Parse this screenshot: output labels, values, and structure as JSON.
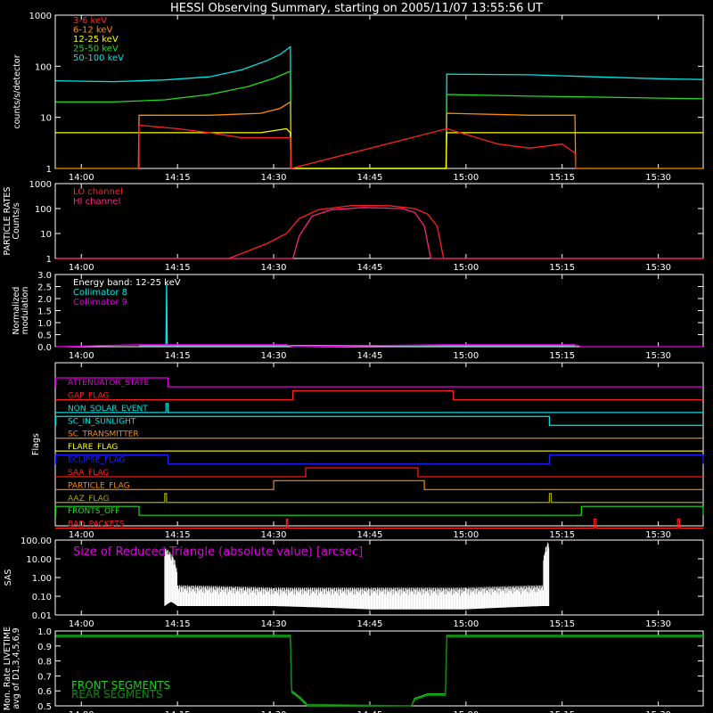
{
  "title": "HESSI Observing Summary, starting on 2005/11/07 13:55:56 UT",
  "colors": {
    "bg": "#000000",
    "axis": "#ffffff",
    "e3_6": "#ff2020",
    "e6_12": "#ff8c00",
    "e12_25": "#ffff00",
    "e25_50": "#22dd22",
    "e50_100": "#00e5e5",
    "lo_channel": "#ff2020",
    "hi_channel": "#ff2080",
    "coll8": "#00e5e5",
    "coll9": "#e000e0",
    "sas_label": "#e000e0",
    "sas_trace": "#ffffff",
    "front": "#22cc22",
    "rear": "#118811"
  },
  "time_ticks": [
    "14:00",
    "14:15",
    "14:30",
    "14:45",
    "15:00",
    "15:15",
    "15:30"
  ],
  "time_axis": {
    "start": "13:55:56",
    "end": "15:37:00"
  },
  "chart_data": [
    {
      "name": "counts",
      "type": "line",
      "ylabel": "counts/s/detector",
      "yscale": "log",
      "ylim": [
        1,
        1000
      ],
      "yticks": [
        "1",
        "10",
        "100",
        "1000"
      ],
      "legend": [
        "3-6 keV",
        "6-12 keV",
        "12-25 keV",
        "25-50 keV",
        "50-100 keV"
      ],
      "series": [
        {
          "name": "50-100 keV",
          "color_key": "e50_100",
          "points": [
            [
              "13:56",
              52
            ],
            [
              "14:05",
              50
            ],
            [
              "14:13",
              54
            ],
            [
              "14:20",
              62
            ],
            [
              "14:25",
              85
            ],
            [
              "14:29",
              130
            ],
            [
              "14:31",
              170
            ],
            [
              "14:32.6",
              240
            ],
            [
              "14:32.7",
              1
            ],
            [
              "14:56.9",
              1
            ],
            [
              "14:57",
              70
            ],
            [
              "15:10",
              68
            ],
            [
              "15:20",
              62
            ],
            [
              "15:30",
              57
            ],
            [
              "15:37",
              55
            ]
          ]
        },
        {
          "name": "25-50 keV",
          "color_key": "e25_50",
          "points": [
            [
              "13:56",
              20
            ],
            [
              "14:05",
              20
            ],
            [
              "14:13",
              22
            ],
            [
              "14:20",
              28
            ],
            [
              "14:26",
              40
            ],
            [
              "14:30",
              58
            ],
            [
              "14:32.6",
              80
            ],
            [
              "14:32.7",
              1
            ],
            [
              "14:56.9",
              1
            ],
            [
              "14:57",
              28
            ],
            [
              "15:10",
              26
            ],
            [
              "15:20",
              25
            ],
            [
              "15:37",
              23
            ]
          ]
        },
        {
          "name": "6-12 keV",
          "color_key": "e6_12",
          "points": [
            [
              "13:56",
              1
            ],
            [
              "14:08.9",
              1
            ],
            [
              "14:09",
              11
            ],
            [
              "14:20",
              11
            ],
            [
              "14:28",
              12
            ],
            [
              "14:31",
              15
            ],
            [
              "14:32.6",
              20
            ],
            [
              "14:32.7",
              1
            ],
            [
              "14:56.9",
              1
            ],
            [
              "14:57",
              12
            ],
            [
              "15:10",
              11
            ],
            [
              "15:17",
              11
            ],
            [
              "15:17.1",
              1
            ],
            [
              "15:37",
              1
            ]
          ]
        },
        {
          "name": "12-25 keV",
          "color_key": "e12_25",
          "points": [
            [
              "13:56",
              5
            ],
            [
              "14:10",
              5
            ],
            [
              "14:20",
              5
            ],
            [
              "14:28",
              5
            ],
            [
              "14:32",
              6
            ],
            [
              "14:32.6",
              5
            ],
            [
              "14:32.7",
              1
            ],
            [
              "14:56.9",
              1
            ],
            [
              "14:57",
              5
            ],
            [
              "15:10",
              5
            ],
            [
              "15:20",
              5
            ],
            [
              "15:30",
              5
            ],
            [
              "15:37",
              5
            ]
          ]
        },
        {
          "name": "3-6 keV",
          "color_key": "e3_6",
          "points": [
            [
              "14:09",
              1
            ],
            [
              "14:09",
              7
            ],
            [
              "14:15",
              6
            ],
            [
              "14:20",
              5
            ],
            [
              "14:25",
              4
            ],
            [
              "14:32.6",
              4
            ],
            [
              "14:32.7",
              1
            ],
            [
              "14:57",
              6
            ],
            [
              "15:05",
              3
            ],
            [
              "15:10",
              2.5
            ],
            [
              "15:15",
              3
            ],
            [
              "15:17",
              2
            ],
            [
              "15:17.1",
              1
            ]
          ]
        }
      ]
    },
    {
      "name": "particle",
      "type": "line",
      "ylabel_lines": [
        "PARTICLE RATES",
        "Counts/s"
      ],
      "yscale": "log",
      "ylim": [
        1,
        1000
      ],
      "yticks": [
        "1",
        "10",
        "100",
        "1000"
      ],
      "legend": [
        "LO channel",
        "HI channel"
      ],
      "series": [
        {
          "name": "LO channel",
          "color_key": "lo_channel",
          "points": [
            [
              "13:56",
              1
            ],
            [
              "14:23",
              1
            ],
            [
              "14:26",
              2
            ],
            [
              "14:29",
              4
            ],
            [
              "14:32",
              10
            ],
            [
              "14:34",
              40
            ],
            [
              "14:37",
              90
            ],
            [
              "14:42",
              130
            ],
            [
              "14:48",
              130
            ],
            [
              "14:52",
              100
            ],
            [
              "14:54",
              60
            ],
            [
              "14:55.5",
              20
            ],
            [
              "14:56.5",
              1
            ],
            [
              "15:37",
              1
            ]
          ]
        },
        {
          "name": "HI channel",
          "color_key": "hi_channel",
          "points": [
            [
              "13:56",
              1
            ],
            [
              "14:33",
              1
            ],
            [
              "14:34",
              8
            ],
            [
              "14:36",
              50
            ],
            [
              "14:39",
              90
            ],
            [
              "14:44",
              110
            ],
            [
              "14:50",
              100
            ],
            [
              "14:52",
              70
            ],
            [
              "14:53.5",
              20
            ],
            [
              "14:54.5",
              1
            ],
            [
              "15:37",
              1
            ]
          ]
        }
      ]
    },
    {
      "name": "modulation",
      "type": "line",
      "ylabel_lines": [
        "Normalized",
        "modulation"
      ],
      "ylim": [
        0,
        3.0
      ],
      "yticks": [
        "0.0",
        "0.5",
        "1.0",
        "1.5",
        "2.0",
        "2.5",
        "3.0"
      ],
      "legend": [
        "Energy band: 12-25 keV",
        "Collimator 8",
        "Collimator 9"
      ],
      "series": [
        {
          "name": "Collimator 8",
          "color_key": "coll8",
          "points": [
            [
              "14:09",
              0.05
            ],
            [
              "14:13.2",
              0.05
            ],
            [
              "14:13.3",
              2.6
            ],
            [
              "14:13.4",
              0.05
            ],
            [
              "14:32",
              0.05
            ],
            [
              "14:57",
              0.05
            ],
            [
              "15:17",
              0.05
            ]
          ]
        },
        {
          "name": "Collimator 9",
          "color_key": "coll9",
          "points": [
            [
              "13:56",
              0.0
            ],
            [
              "14:09",
              0.08
            ],
            [
              "14:32",
              0.08
            ],
            [
              "14:33",
              0.0
            ],
            [
              "14:57",
              0.08
            ],
            [
              "15:17",
              0.08
            ],
            [
              "15:18",
              0.0
            ],
            [
              "15:37",
              0.0
            ]
          ]
        }
      ]
    },
    {
      "name": "flags",
      "type": "line",
      "ylabel": "Flags",
      "flags": [
        {
          "name": "ATTENUATOR_STATE",
          "color": "#e000e0",
          "high": [
            [
              "13:56",
              "14:13.5"
            ]
          ]
        },
        {
          "name": "GAP_FLAG",
          "color": "#ff2020",
          "high": [
            [
              "14:33",
              "14:58"
            ]
          ]
        },
        {
          "name": "NON_SOLAR_EVENT",
          "color": "#00e5e5",
          "high": [
            [
              "14:13.2",
              "14:13.5"
            ]
          ]
        },
        {
          "name": "SC_IN_SUNLIGHT",
          "color": "#00e5e5",
          "high": [
            [
              "13:56",
              "15:13"
            ]
          ]
        },
        {
          "name": "SC_TRANSMITTER",
          "color": "#ff8c00",
          "high": []
        },
        {
          "name": "FLARE_FLAG",
          "color": "#ffff00",
          "high": []
        },
        {
          "name": "ECLIPSE_FLAG",
          "color": "#2020ff",
          "high": [
            [
              "13:56",
              "14:13.5"
            ],
            [
              "15:13",
              "15:37"
            ]
          ]
        },
        {
          "name": "SAA_FLAG",
          "color": "#ff2020",
          "high": [
            [
              "14:35",
              "14:52.5"
            ]
          ]
        },
        {
          "name": "PARTICLE_FLAG",
          "color": "#ff8c00",
          "high": [
            [
              "14:30",
              "14:53.5"
            ]
          ]
        },
        {
          "name": "AAZ_FLAG",
          "color": "#aaaa00",
          "high": [
            [
              "14:13",
              "14:13.3"
            ],
            [
              "15:13",
              "15:13.3"
            ]
          ]
        },
        {
          "name": "FRONTS_OFF",
          "color": "#22dd22",
          "high": [
            [
              "13:56",
              "14:09"
            ],
            [
              "15:18",
              "15:37"
            ]
          ]
        },
        {
          "name": "BAD_PACKETS",
          "color": "#ff2020",
          "high": [
            [
              "14:32",
              "14:32.2"
            ],
            [
              "15:20",
              "15:20.3"
            ],
            [
              "15:33",
              "15:33.3"
            ]
          ]
        }
      ]
    },
    {
      "name": "sas",
      "type": "line",
      "ylabel": "SAS",
      "yscale": "log",
      "ylim": [
        0.01,
        100
      ],
      "yticks": [
        "0.01",
        "0.10",
        "1.00",
        "10.00",
        "100.00"
      ],
      "legend": [
        "Size of Reduced Triangle (absolute value) [arcsec]"
      ],
      "series": [
        {
          "name": "Size of Reduced Triangle (absolute value) [arcsec]",
          "color_key": "sas_trace",
          "band": [
            [
              "14:13",
              0.03,
              40
            ],
            [
              "14:14",
              0.05,
              20
            ],
            [
              "14:15",
              0.03,
              0.4
            ],
            [
              "14:30",
              0.03,
              0.3
            ],
            [
              "14:45",
              0.02,
              0.3
            ],
            [
              "15:00",
              0.02,
              0.3
            ],
            [
              "15:12",
              0.03,
              0.4
            ],
            [
              "15:13",
              0.03,
              100
            ]
          ]
        }
      ]
    },
    {
      "name": "livetime",
      "type": "line",
      "ylabel_lines": [
        "Mon. Rate LIVETIME",
        "avg of D1,3,4,5,6,9"
      ],
      "ylim": [
        0.5,
        1.0
      ],
      "yticks": [
        "0.5",
        "0.6",
        "0.7",
        "0.8",
        "0.9",
        "1.0"
      ],
      "legend": [
        "FRONT SEGMENTS",
        "REAR SEGMENTS"
      ],
      "series": [
        {
          "name": "FRONT SEGMENTS",
          "color_key": "front",
          "points": [
            [
              "13:56",
              0.97
            ],
            [
              "14:32.6",
              0.97
            ],
            [
              "14:32.8",
              0.6
            ],
            [
              "14:34",
              0.56
            ],
            [
              "14:35",
              0.52
            ],
            [
              "14:35.2",
              0.5
            ],
            [
              "14:51.5",
              0.5
            ],
            [
              "14:52",
              0.55
            ],
            [
              "14:54",
              0.58
            ],
            [
              "14:56.8",
              0.58
            ],
            [
              "14:57",
              0.97
            ],
            [
              "15:37",
              0.97
            ]
          ]
        },
        {
          "name": "REAR SEGMENTS",
          "color_key": "rear",
          "points": [
            [
              "13:56",
              0.96
            ],
            [
              "14:32.6",
              0.96
            ],
            [
              "14:32.8",
              0.59
            ],
            [
              "14:34",
              0.55
            ],
            [
              "14:35",
              0.51
            ],
            [
              "14:51.5",
              0.5
            ],
            [
              "14:52",
              0.54
            ],
            [
              "14:54",
              0.57
            ],
            [
              "14:56.8",
              0.57
            ],
            [
              "14:57",
              0.96
            ],
            [
              "15:37",
              0.96
            ]
          ]
        }
      ]
    }
  ]
}
